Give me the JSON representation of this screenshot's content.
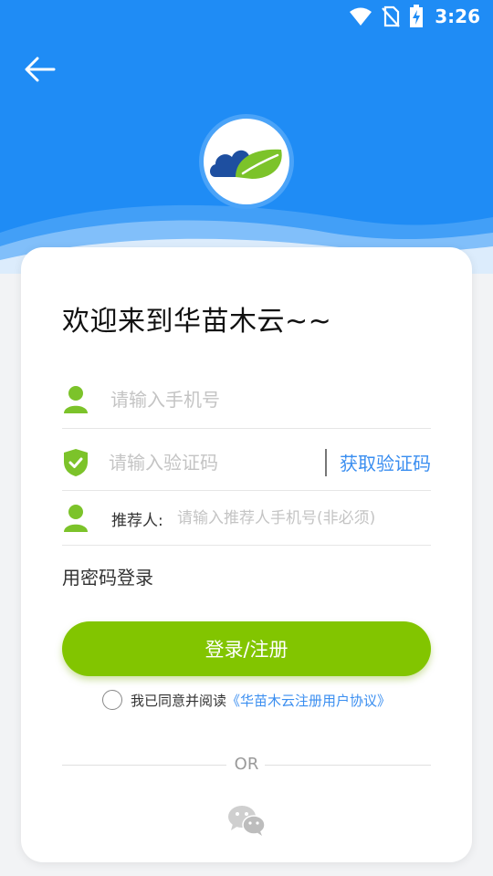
{
  "status_bar": {
    "time": "3:26",
    "icons": [
      "wifi-icon",
      "no-sim-icon",
      "battery-charging-icon"
    ]
  },
  "colors": {
    "header_blue": "#1f8cf5",
    "accent_green": "#82c500",
    "link_blue": "#3a8ef0"
  },
  "login": {
    "welcome": "欢迎来到华苗木云~~",
    "phone_placeholder": "请输入手机号",
    "code_placeholder": "请输入验证码",
    "get_code_label": "获取验证码",
    "referrer_label": "推荐人:",
    "referrer_placeholder": "请输入推荐人手机号(非必须)",
    "password_login_label": "用密码登录",
    "submit_label": "登录/注册",
    "agree_prefix": "我已同意并阅读",
    "agreement_link": "《华苗木云注册用户协议》",
    "or_label": "OR"
  }
}
